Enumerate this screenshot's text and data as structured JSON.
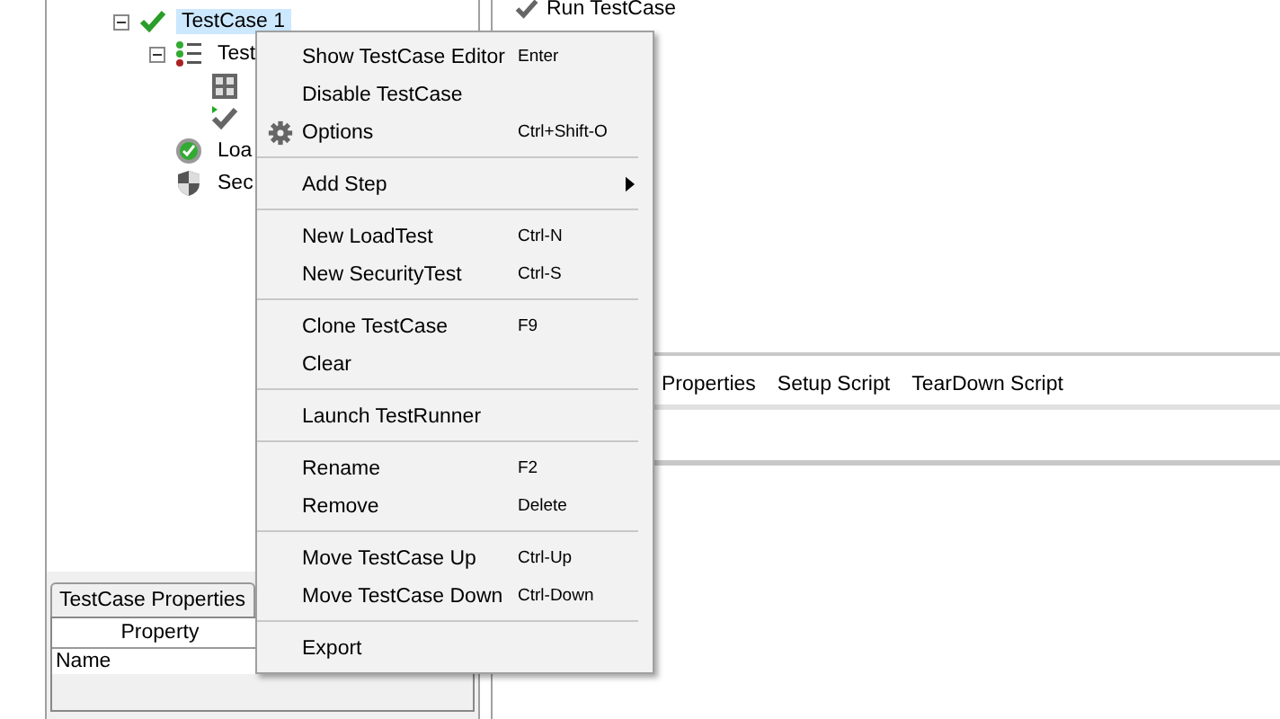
{
  "tree": {
    "items": [
      {
        "label": "TestCase 1",
        "kind": "testcase",
        "selected": true,
        "expanded": true,
        "children": [
          {
            "label": "Test",
            "kind": "steps",
            "selected": false,
            "expanded": true,
            "children": [
              {
                "kind": "soap-step",
                "selected": false
              },
              {
                "kind": "run-step",
                "selected": false
              }
            ]
          },
          {
            "label": "Loa",
            "kind": "loadtest",
            "selected": false
          },
          {
            "label": "Sec",
            "kind": "securitytest",
            "selected": false
          }
        ]
      }
    ]
  },
  "properties_panel": {
    "tab": "TestCase Properties",
    "columns": [
      "Property"
    ],
    "rows": [
      [
        "Name"
      ]
    ]
  },
  "editor": {
    "run_button": "Run TestCase",
    "tabs": [
      "Properties",
      "Setup Script",
      "TearDown Script"
    ]
  },
  "context_menu": {
    "items": [
      {
        "kind": "command",
        "label": "Show TestCase Editor",
        "shortcut": "Enter"
      },
      {
        "kind": "command",
        "label": "Disable TestCase"
      },
      {
        "kind": "gear-command",
        "label": "Options",
        "shortcut": "Ctrl+Shift-O"
      },
      {
        "kind": "separator"
      },
      {
        "kind": "submenu",
        "label": "Add Step"
      },
      {
        "kind": "separator"
      },
      {
        "kind": "command",
        "label": "New LoadTest",
        "shortcut": "Ctrl-N"
      },
      {
        "kind": "command",
        "label": "New SecurityTest",
        "shortcut": "Ctrl-S"
      },
      {
        "kind": "separator"
      },
      {
        "kind": "command",
        "label": "Clone TestCase",
        "shortcut": "F9"
      },
      {
        "kind": "command",
        "label": "Clear"
      },
      {
        "kind": "separator"
      },
      {
        "kind": "command",
        "label": "Launch TestRunner"
      },
      {
        "kind": "separator"
      },
      {
        "kind": "command",
        "label": "Rename",
        "shortcut": "F2"
      },
      {
        "kind": "command",
        "label": "Remove",
        "shortcut": "Delete"
      },
      {
        "kind": "separator"
      },
      {
        "kind": "command",
        "label": "Move TestCase Up",
        "shortcut": "Ctrl-Up"
      },
      {
        "kind": "command",
        "label": "Move TestCase Down",
        "shortcut": "Ctrl-Down"
      },
      {
        "kind": "separator"
      },
      {
        "kind": "command",
        "label": "Export"
      }
    ]
  }
}
